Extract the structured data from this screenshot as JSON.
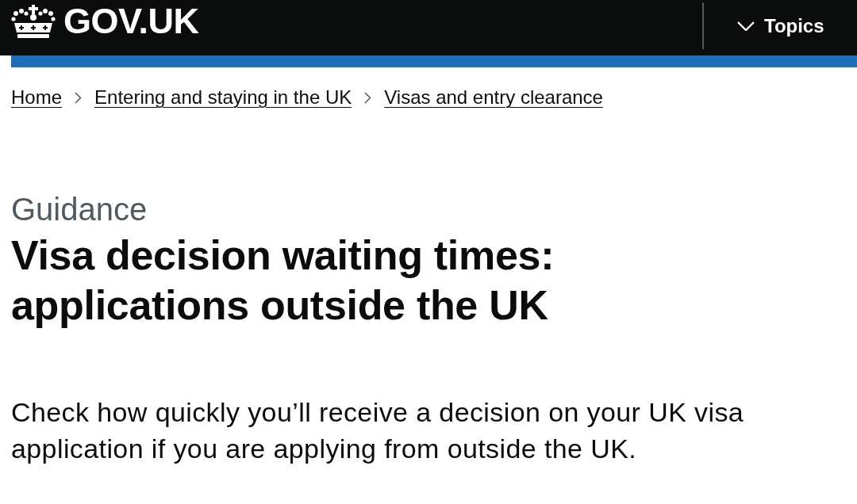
{
  "header": {
    "logo_text": "GOV.UK",
    "topics_button": {
      "label": "Topics",
      "expanded": false
    }
  },
  "breadcrumbs": [
    "Home",
    "Entering and staying in the UK",
    "Visas and entry clearance"
  ],
  "content": {
    "document_type": "Guidance",
    "title": "Visa decision waiting times: applications outside the UK",
    "summary": "Check how quickly you’ll receive a decision on your UK visa application if you are applying from outside the UK."
  }
}
